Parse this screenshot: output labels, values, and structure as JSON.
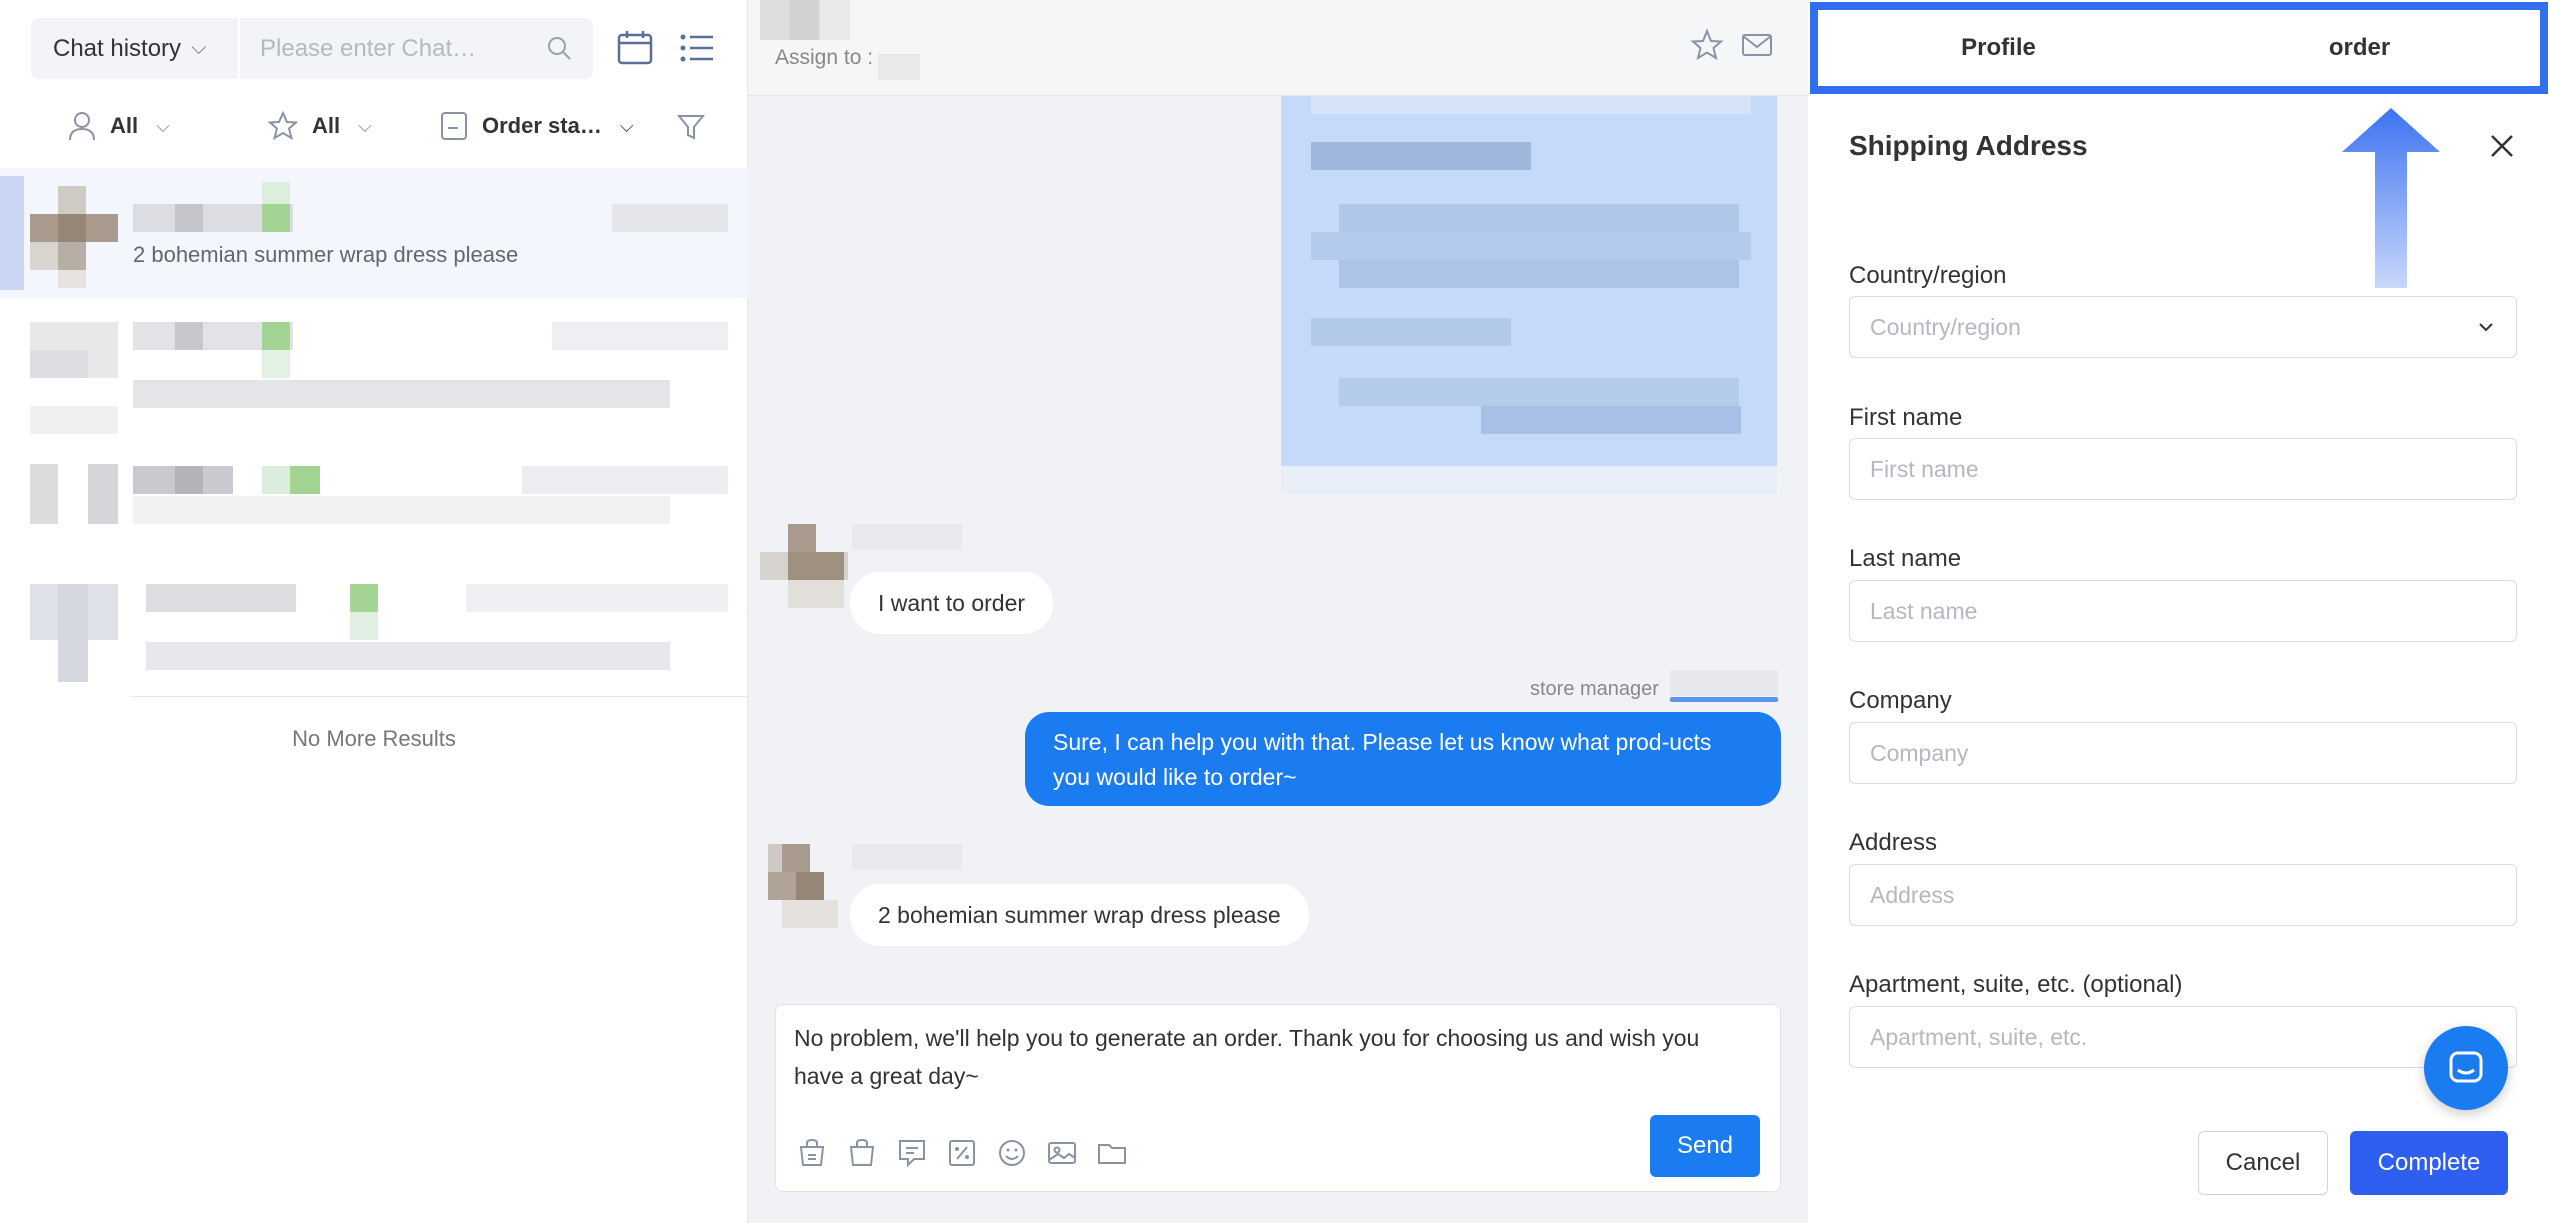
{
  "left_panel": {
    "history_select": "Chat history",
    "search_placeholder": "Please enter Chat…",
    "filters": [
      {
        "label": "All",
        "icon": "user-icon"
      },
      {
        "label": "All",
        "icon": "star-icon"
      },
      {
        "label": "Order sta…",
        "icon": "order-status-icon"
      }
    ],
    "conversations": [
      {
        "preview": "2 bohemian summer wrap dress please",
        "active": true
      },
      {
        "preview": "",
        "active": false
      },
      {
        "preview": "",
        "active": false
      },
      {
        "preview": "",
        "active": false
      }
    ],
    "no_more": "No More Results"
  },
  "chat": {
    "assign_label": "Assign to :",
    "messages": [
      {
        "from": "customer",
        "text": "I want to order"
      },
      {
        "from": "agent",
        "sender": "store manager",
        "text": "Sure, I can help you with that. Please let us know what prod-ucts you would like to order~"
      },
      {
        "from": "customer",
        "text": "2 bohemian summer wrap dress please"
      }
    ],
    "compose_text": "No problem, we'll help you to generate an order. Thank you for choosing us and wish you have a great day~",
    "send_label": "Send"
  },
  "right_panel": {
    "tabs": [
      "Profile",
      "order"
    ],
    "title": "Shipping Address",
    "fields": [
      {
        "label": "Country/region",
        "placeholder": "Country/region",
        "type": "select"
      },
      {
        "label": "First name",
        "placeholder": "First name"
      },
      {
        "label": "Last name",
        "placeholder": "Last name"
      },
      {
        "label": "Company",
        "placeholder": "Company"
      },
      {
        "label": "Address",
        "placeholder": "Address"
      },
      {
        "label": "Apartment, suite, etc. (optional)",
        "placeholder": "Apartment, suite, etc."
      }
    ],
    "cancel_label": "Cancel",
    "complete_label": "Complete"
  },
  "colors": {
    "accent": "#1b7bf0",
    "highlight_border": "#2f6ff0",
    "complete": "#2f5ff0"
  }
}
